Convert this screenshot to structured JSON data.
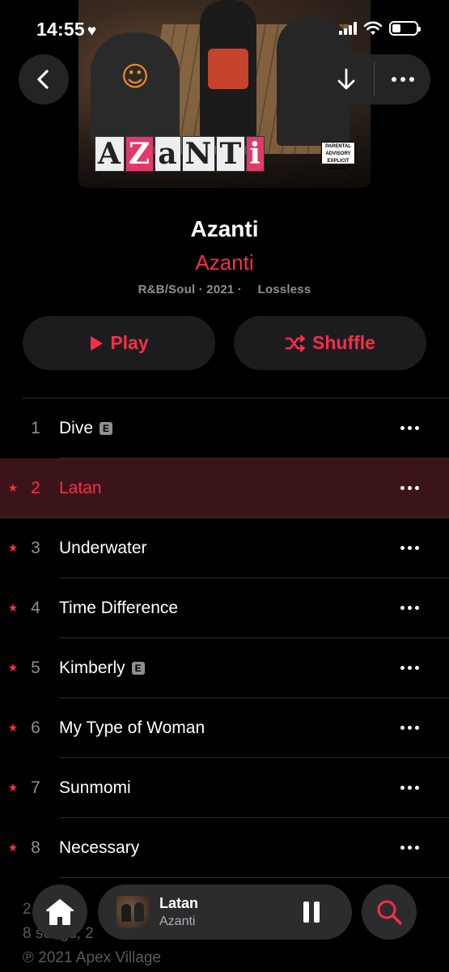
{
  "status_bar": {
    "time": "14:55",
    "heart": "♥"
  },
  "album": {
    "cover_logo": [
      "A",
      "Z",
      "a",
      "N",
      "T",
      "i"
    ],
    "advisory": "PARENTAL ADVISORY EXPLICIT CONTENT",
    "title": "Azanti",
    "artist": "Azanti",
    "meta": "R&B/Soul · 2021 ·  Lossless"
  },
  "actions": {
    "play_label": "Play",
    "shuffle_label": "Shuffle"
  },
  "tracks": [
    {
      "num": "1",
      "title": "Dive",
      "explicit": "E",
      "starred": false,
      "active": false
    },
    {
      "num": "2",
      "title": "Latan",
      "explicit": "",
      "starred": true,
      "active": true
    },
    {
      "num": "3",
      "title": "Underwater",
      "explicit": "",
      "starred": true,
      "active": false
    },
    {
      "num": "4",
      "title": "Time Difference",
      "explicit": "",
      "starred": true,
      "active": false
    },
    {
      "num": "5",
      "title": "Kimberly",
      "explicit": "E",
      "starred": true,
      "active": false
    },
    {
      "num": "6",
      "title": "My Type of Woman",
      "explicit": "",
      "starred": true,
      "active": false
    },
    {
      "num": "7",
      "title": "Sunmomi",
      "explicit": "",
      "starred": true,
      "active": false
    },
    {
      "num": "8",
      "title": "Necessary",
      "explicit": "",
      "starred": true,
      "active": false
    }
  ],
  "footer": {
    "line1": "2",
    "line2": "8 songs, 2",
    "line3": "℗ 2021 Apex Village"
  },
  "mini_player": {
    "title": "Latan",
    "artist": "Azanti"
  },
  "colors": {
    "accent": "#fa2d48",
    "background": "#000000",
    "surface": "#1c1c1e"
  }
}
